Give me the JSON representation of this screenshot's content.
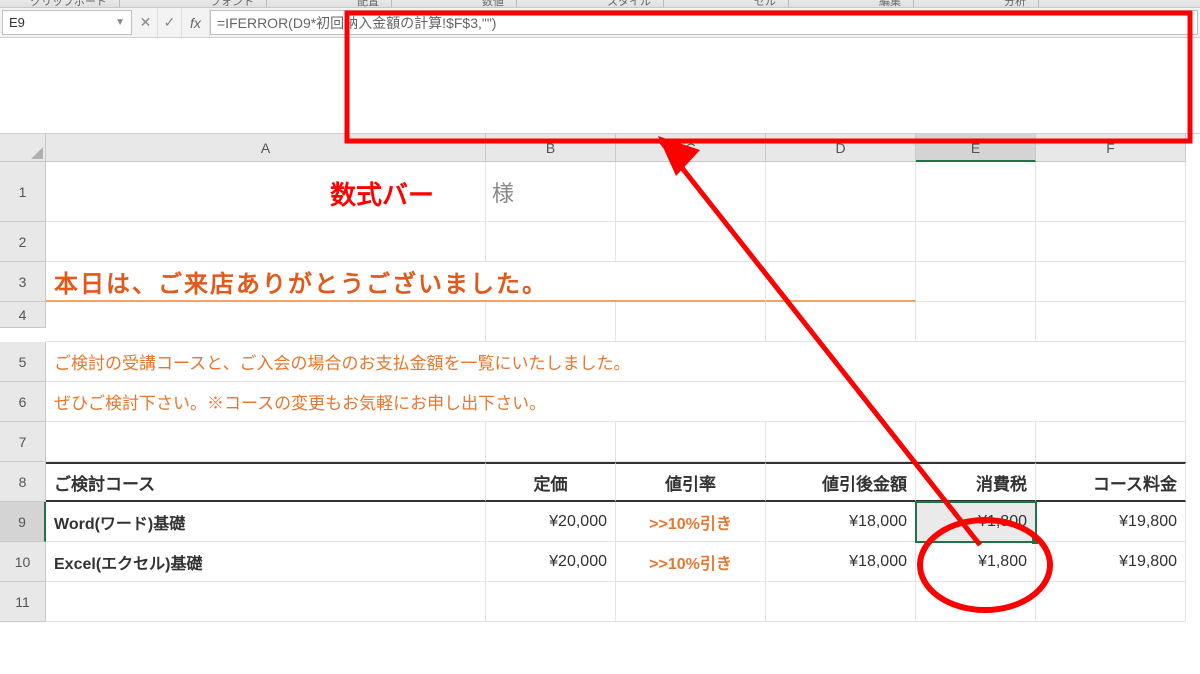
{
  "ribbon_groups": [
    "クリップボード",
    "フォント",
    "配置",
    "数値",
    "スタイル",
    "セル",
    "編集",
    "分析"
  ],
  "cell_ref": "E9",
  "formula": "=IFERROR(D9*初回納入金額の計算!$F$3,\"\")",
  "annotation_label": "数式バー",
  "columns": [
    "A",
    "B",
    "C",
    "D",
    "E",
    "F"
  ],
  "rows": {
    "1": {
      "b_sama": "様"
    },
    "3": {
      "greeting": "本日は、ご来店ありがとうございました。"
    },
    "5": {
      "text": "ご検討の受講コースと、ご入会の場合のお支払金額を一覧にいたしました。"
    },
    "6": {
      "text": "ぜひご検討下さい。※コースの変更もお気軽にお申し出下さい。"
    },
    "8": {
      "a": "ご検討コース",
      "b": "定価",
      "c": "値引率",
      "d": "値引後金額",
      "e": "消費税",
      "f": "コース料金"
    },
    "9": {
      "a": "Word(ワード)基礎",
      "b": "¥20,000",
      "c": ">>10%引き",
      "d": "¥18,000",
      "e": "¥1,800",
      "f": "¥19,800"
    },
    "10": {
      "a": "Excel(エクセル)基礎",
      "b": "¥20,000",
      "c": ">>10%引き",
      "d": "¥18,000",
      "e": "¥1,800",
      "f": "¥19,800"
    }
  },
  "row_numbers": [
    "1",
    "2",
    "3",
    "4",
    "5",
    "6",
    "7",
    "8",
    "9",
    "10",
    "11"
  ]
}
